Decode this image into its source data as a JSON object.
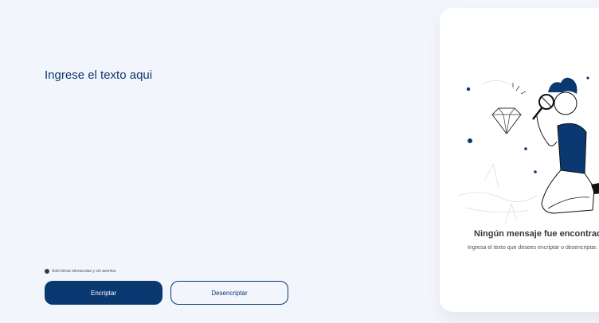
{
  "input": {
    "placeholder": "Ingrese el texto aqui",
    "value": ""
  },
  "hint": {
    "icon": "info-icon",
    "text": "Solo letras minúsculas y sin acentos"
  },
  "buttons": {
    "encrypt_label": "Encriptar",
    "decrypt_label": "Desencriptar"
  },
  "output_panel": {
    "illustration": "person-with-magnifying-glass",
    "title": "Ningún mensaje fue encontrado",
    "subtitle": "Ingresa el texto que desees encriptar o desencriptar."
  },
  "colors": {
    "background": "#f3f5fc",
    "primary": "#0a3871",
    "panel": "#ffffff"
  }
}
